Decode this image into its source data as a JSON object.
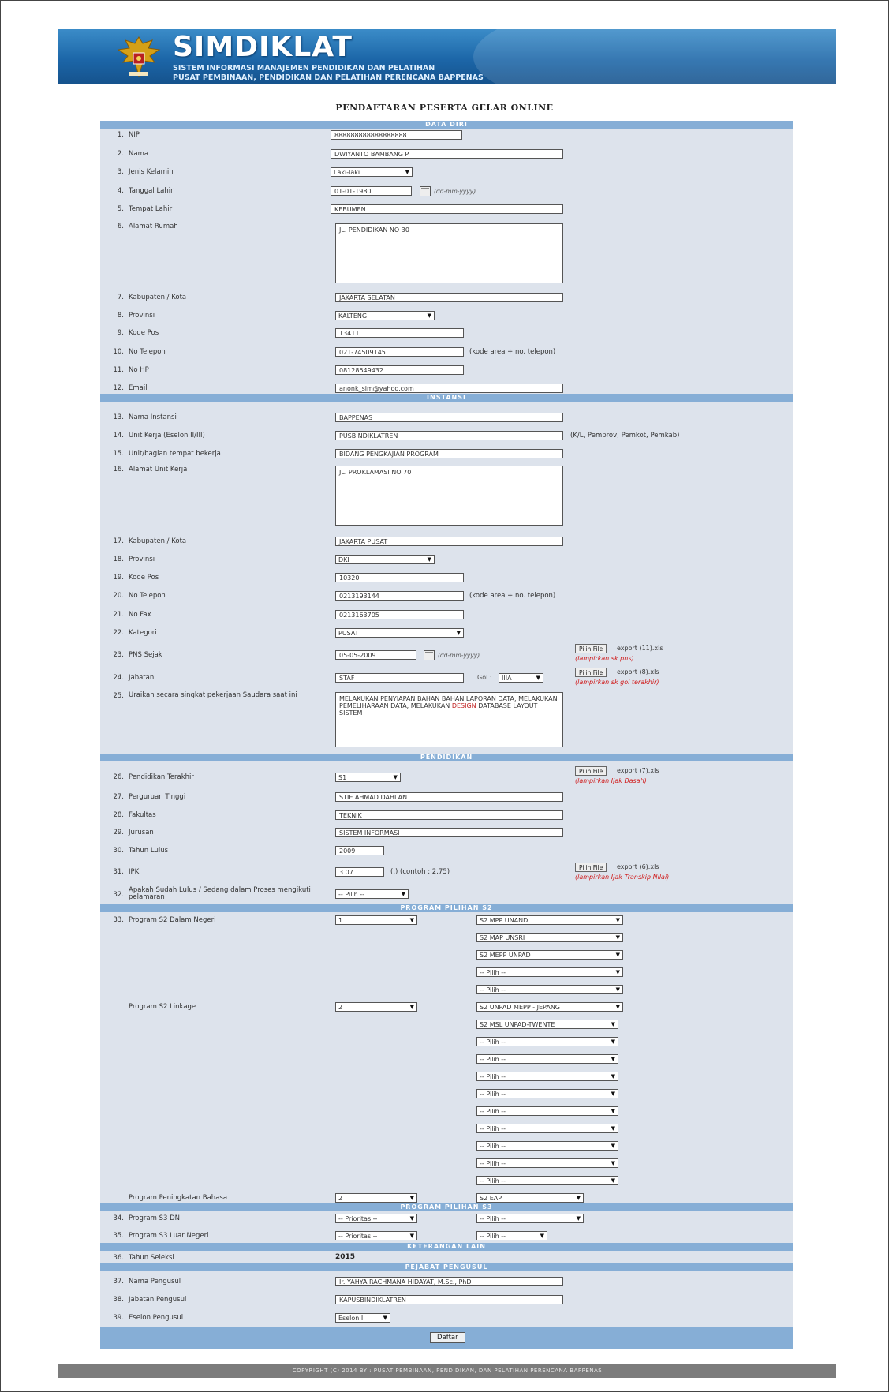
{
  "header": {
    "title": "SIMDIKLAT",
    "subtitle1": "SISTEM INFORMASI MANAJEMEN PENDIDIKAN DAN PELATIHAN",
    "subtitle2": "PUSAT PEMBINAAN, PENDIDIKAN DAN PELATIHAN PERENCANA BAPPENAS"
  },
  "form_title": "PENDAFTARAN PESERTA GELAR ONLINE",
  "sections": {
    "data_diri": "DATA DIRI",
    "instansi": "INSTANSI",
    "pendidikan": "PENDIDIKAN",
    "program_s2": "PROGRAM PILIHAN S2",
    "program_s3": "PROGRAM PILIHAN S3",
    "keterangan": "KETERANGAN LAIN",
    "pejabat": "PEJABAT PENGUSUL"
  },
  "fields": {
    "nip": {
      "num": "1.",
      "label": "NIP",
      "value": "888888888888888888"
    },
    "nama": {
      "num": "2.",
      "label": "Nama",
      "value": "DWIYANTO BAMBANG P"
    },
    "jenis_kelamin": {
      "num": "3.",
      "label": "Jenis Kelamin",
      "value": "Laki-laki"
    },
    "tanggal_lahir": {
      "num": "4.",
      "label": "Tanggal Lahir",
      "value": "01-01-1980",
      "hint": "(dd-mm-yyyy)"
    },
    "tempat_lahir": {
      "num": "5.",
      "label": "Tempat Lahir",
      "value": "KEBUMEN"
    },
    "alamat_rumah": {
      "num": "6.",
      "label": "Alamat Rumah",
      "value": "JL. PENDIDIKAN NO 30"
    },
    "kabupaten": {
      "num": "7.",
      "label": "Kabupaten / Kota",
      "value": "JAKARTA SELATAN"
    },
    "provinsi": {
      "num": "8.",
      "label": "Provinsi",
      "value": "KALTENG"
    },
    "kode_pos": {
      "num": "9.",
      "label": "Kode Pos",
      "value": "13411"
    },
    "no_telepon": {
      "num": "10.",
      "label": "No Telepon",
      "value": "021-74509145",
      "hint": "(kode area + no. telepon)"
    },
    "no_hp": {
      "num": "11.",
      "label": "No HP",
      "value": "08128549432"
    },
    "email": {
      "num": "12.",
      "label": "Email",
      "value": "anonk_sim@yahoo.com"
    },
    "nama_instansi": {
      "num": "13.",
      "label": "Nama Instansi",
      "value": "BAPPENAS"
    },
    "unit_kerja": {
      "num": "14.",
      "label": "Unit Kerja (Eselon II/III)",
      "value": "PUSBINDIKLATREN",
      "hint": "(K/L, Pemprov, Pemkot, Pemkab)"
    },
    "unit_bagian": {
      "num": "15.",
      "label": "Unit/bagian tempat bekerja",
      "value": "BIDANG PENGKAJIAN PROGRAM"
    },
    "alamat_unit": {
      "num": "16.",
      "label": "Alamat Unit Kerja",
      "value": "JL. PROKLAMASI NO 70"
    },
    "kabupaten_unit": {
      "num": "17.",
      "label": "Kabupaten / Kota",
      "value": "JAKARTA PUSAT"
    },
    "provinsi_unit": {
      "num": "18.",
      "label": "Provinsi",
      "value": "DKI"
    },
    "kode_pos_unit": {
      "num": "19.",
      "label": "Kode Pos",
      "value": "10320"
    },
    "no_telepon_unit": {
      "num": "20.",
      "label": "No Telepon",
      "value": "0213193144",
      "hint": "(kode area + no. telepon)"
    },
    "no_fax": {
      "num": "21.",
      "label": "No Fax",
      "value": "0213163705"
    },
    "kategori": {
      "num": "22.",
      "label": "Kategori",
      "value": "PUSAT"
    },
    "pns_sejak": {
      "num": "23.",
      "label": "PNS Sejak",
      "value": "05-05-2009",
      "hint": "(dd-mm-yyyy)",
      "file_btn": "Pilih File",
      "file_name": "export (11).xls",
      "file_note": "(lampirkan sk pns)"
    },
    "jabatan": {
      "num": "24.",
      "label": "Jabatan",
      "value": "STAF",
      "gol_label": "Gol :",
      "gol_value": "IIIA",
      "file_btn": "Pilih File",
      "file_name": "export (8).xls",
      "file_note": "(lampirkan sk gol terakhir)"
    },
    "uraian": {
      "num": "25.",
      "label": "Uraikan secara singkat pekerjaan Saudara saat ini",
      "value_pre": "MELAKUKAN PENYIAPAN BAHAN BAHAN LAPORAN DATA, MELAKUKAN PEMELIHARAAN DATA, MELAKUKAN ",
      "value_link": "DESIGN",
      "value_post": " DATABASE LAYOUT SISTEM"
    },
    "pendidikan_terakhir": {
      "num": "26.",
      "label": "Pendidikan Terakhir",
      "value": "S1",
      "file_btn": "Pilih File",
      "file_name": "export (7).xls",
      "file_note": "(lampirkan Ijak Dasah)"
    },
    "perguruan_tinggi": {
      "num": "27.",
      "label": "Perguruan Tinggi",
      "value": "STIE AHMAD DAHLAN"
    },
    "fakultas": {
      "num": "28.",
      "label": "Fakultas",
      "value": "TEKNIK"
    },
    "jurusan": {
      "num": "29.",
      "label": "Jurusan",
      "value": "SISTEM INFORMASI"
    },
    "tahun_lulus": {
      "num": "30.",
      "label": "Tahun Lulus",
      "value": "2009"
    },
    "ipk": {
      "num": "31.",
      "label": "IPK",
      "value": "3.07",
      "hint": "(.) (contoh : 2.75)",
      "file_btn": "Pilih File",
      "file_name": "export (6).xls",
      "file_note": "(lampirkan Ijak Transkip Nilai)"
    },
    "sudah_lulus": {
      "num": "32.",
      "label": "Apakah Sudah Lulus / Sedang dalam Proses mengikuti pelamaran",
      "value": "-- Pilih --"
    },
    "program_s2_dn": {
      "num": "33.",
      "label": "Program S2 Dalam Negeri",
      "count": "1",
      "options": [
        "S2 MPP UNAND",
        "S2 MAP UNSRI",
        "S2 MEPP UNPAD",
        "-- Pilih --",
        "-- Pilih --"
      ]
    },
    "program_s2_linkage": {
      "label": "Program S2 Linkage",
      "count": "2",
      "options": [
        "S2 UNPAD MEPP - JEPANG",
        "S2 MSL UNPAD-TWENTE",
        "-- Pilih --",
        "-- Pilih --",
        "-- Pilih --",
        "-- Pilih --",
        "-- Pilih --",
        "-- Pilih --",
        "-- Pilih --",
        "-- Pilih --",
        "-- Pilih --"
      ]
    },
    "program_bahasa": {
      "label": "Program Peningkatan Bahasa",
      "count": "2",
      "option": "S2 EAP"
    },
    "program_s3_dn": {
      "num": "34.",
      "label": "Program S3 DN",
      "priority": "-- Prioritas --",
      "choice": "-- Pilih --"
    },
    "program_s3_ln": {
      "num": "35.",
      "label": "Program S3 Luar Negeri",
      "priority": "-- Prioritas --",
      "choice": "-- Pilih --"
    },
    "tahun_seleksi": {
      "num": "36.",
      "label": "Tahun Seleksi",
      "value": "2015"
    },
    "nama_pengusul": {
      "num": "37.",
      "label": "Nama Pengusul",
      "value": "Ir. YAHYA RACHMANA HIDAYAT, M.Sc., PhD"
    },
    "jabatan_pengusul": {
      "num": "38.",
      "label": "Jabatan Pengusul",
      "value": "KAPUSBINDIKLATREN"
    },
    "eselon_pengusul": {
      "num": "39.",
      "label": "Eselon Pengusul",
      "value": "Eselon II"
    }
  },
  "submit_label": "Daftar",
  "footer": "COPYRIGHT (C) 2014 BY : PUSAT PEMBINAAN, PENDIDIKAN, DAN PELATIHAN PERENCANA BAPPENAS",
  "colors": {
    "banner": "#1c66a8",
    "section": "#86aed6",
    "form_bg": "#dde3ec",
    "note": "#d01b1b"
  }
}
